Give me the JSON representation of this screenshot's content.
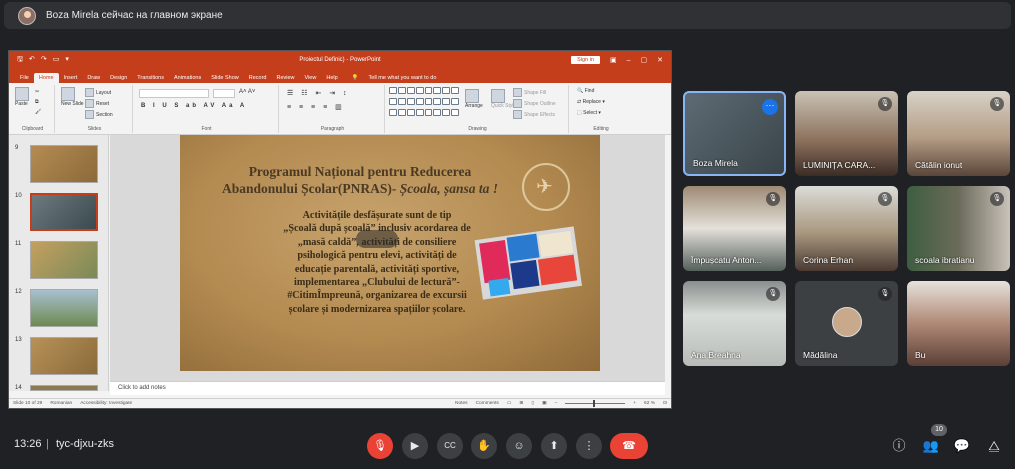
{
  "notification": {
    "text": "Boza Mirela сейчас на главном экране"
  },
  "powerpoint": {
    "window_title": "Proiectul Definic) - PowerPoint",
    "sign_in": "Sign in",
    "tabs": [
      "File",
      "Home",
      "Insert",
      "Draw",
      "Design",
      "Transitions",
      "Animations",
      "Slide Show",
      "Record",
      "Review",
      "View",
      "Help"
    ],
    "active_tab": "Home",
    "tell_me": "Tell me what you want to do",
    "ribbon": {
      "clipboard": "Clipboard",
      "paste": "Paste",
      "slides": "Slides",
      "new_slide": "New Slide",
      "layout": "Layout",
      "reset": "Reset",
      "section": "Section",
      "font": "Font",
      "paragraph": "Paragraph",
      "drawing": "Drawing",
      "arrange": "Arrange",
      "quick_styles": "Quick Styles",
      "shape_fill": "Shape Fill",
      "shape_outline": "Shape Outline",
      "shape_effects": "Shape Effects",
      "editing": "Editing",
      "find": "Find",
      "replace": "Replace",
      "select": "Select"
    },
    "thumbnails": [
      {
        "number": "9",
        "selected": false
      },
      {
        "number": "10",
        "selected": true
      },
      {
        "number": "11",
        "selected": false
      },
      {
        "number": "12",
        "selected": false
      },
      {
        "number": "13",
        "selected": false
      },
      {
        "number": "14",
        "selected": false
      }
    ],
    "slide": {
      "title_line1": "Programul Național pentru Reducerea",
      "title_line2_plain": "Abandonului Școlar(PNRAS)- ",
      "title_line2_italic": "Școala, șansa ta !",
      "body": [
        "Activitățile desfășurate sunt de tip",
        "„Școală după școală” inclusiv acordarea de",
        "„masă caldă”, activități de consiliere",
        "psihologică pentru elevi, activități de",
        "educație parentală, activități sportive,",
        "implementarea „Clubului de lectură”-",
        "#CitimÎmpreună, organizarea de excursii",
        "școlare și modernizarea spațiilor școlare."
      ]
    },
    "notes_placeholder": "Click to add notes",
    "status": {
      "slide_of": "Slide 10 of 29",
      "language": "Romanian",
      "accessibility": "Accessibility: Investigate",
      "notes": "Notes",
      "comments": "Comments",
      "zoom": "62 %"
    },
    "colors": {
      "accent": "#c43e1c"
    }
  },
  "participants": [
    {
      "name": "Boza Mirela",
      "active": true,
      "muted": false
    },
    {
      "name": "LUMINIȚA CARA...",
      "active": false,
      "muted": true
    },
    {
      "name": "Cătălin ionut",
      "active": false,
      "muted": true
    },
    {
      "name": "Împușcatu Anton...",
      "active": false,
      "muted": true
    },
    {
      "name": "Corina Erhan",
      "active": false,
      "muted": true
    },
    {
      "name": "scoala ibratianu",
      "active": false,
      "muted": true
    },
    {
      "name": "Ana Breahna",
      "active": false,
      "muted": true
    },
    {
      "name": "Mădălina",
      "active": false,
      "muted": true
    },
    {
      "name": "Bu",
      "active": false,
      "muted": false
    }
  ],
  "meeting": {
    "time": "13:26",
    "separator": "|",
    "code": "tyc-djxu-zks",
    "people_count": "10",
    "colors": {
      "danger": "#ea4335",
      "control_bg": "#3c4043",
      "active_border": "#8ab4f8"
    }
  }
}
